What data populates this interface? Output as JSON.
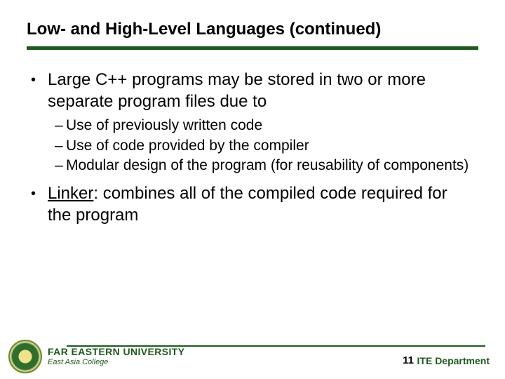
{
  "title": "Low- and High-Level Languages (continued)",
  "bullets": {
    "b1": "Large C++ programs may be stored in two or more separate program files due to",
    "b1_subs": {
      "s1": "Use of previously written code",
      "s2": "Use of code provided by the compiler",
      "s3": "Modular design of the program (for reusability of components)"
    },
    "b2_term": "Linker",
    "b2_rest": ": combines all of the compiled code required for the program"
  },
  "footer": {
    "page_number": "11",
    "department": "ITE Department",
    "university_name": "FAR EASTERN UNIVERSITY",
    "university_sub": "East Asia College"
  }
}
